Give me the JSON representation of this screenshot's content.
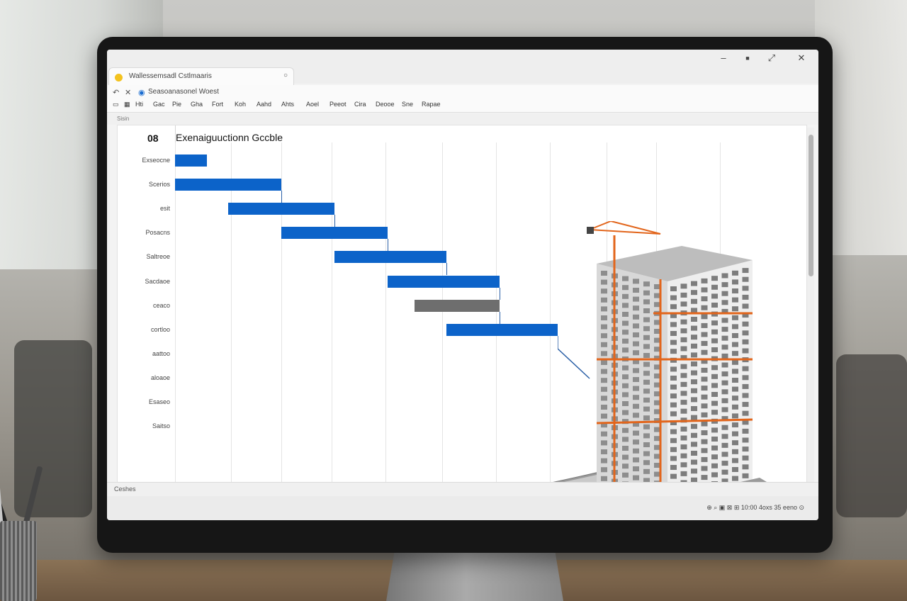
{
  "window": {
    "tab_title": "Wallessemsadl Cstlmaaris",
    "close_glyph": "○",
    "minimize_glyph": "–",
    "maximize_glyph": "■",
    "window_close_glyph": "✕"
  },
  "address_bar": {
    "back_glyph": "↶",
    "close_glyph": "✕",
    "text": "Seasoanasonel Woest"
  },
  "menu": {
    "items": [
      "Hti",
      "Gac",
      "Pie",
      "Gha",
      "Fort",
      "Koh",
      "Aahd",
      "Ahts",
      "Aoel",
      "Peeot",
      "Cira",
      "Deooe",
      "Sne",
      "Rapae"
    ]
  },
  "subbar": {
    "label": "Sisin"
  },
  "chart_data": {
    "type": "gantt",
    "id_label": "08",
    "title": "Exenaiguuctionn Gccble",
    "row_labels": [
      "Exseocne",
      "Scerios",
      "esit",
      "Posacns",
      "Saltreoe",
      "Sacdaoe",
      "ceaco",
      "cortloo",
      "aattoo",
      "aloaoe",
      "Esaseo",
      "Saitso"
    ],
    "tasks": [
      {
        "row": 0,
        "start": 0.0,
        "end": 0.6,
        "color": "#0c63c9"
      },
      {
        "row": 1,
        "start": 0.0,
        "end": 2.0,
        "color": "#0c63c9"
      },
      {
        "row": 2,
        "start": 1.0,
        "end": 3.0,
        "color": "#0c63c9"
      },
      {
        "row": 3,
        "start": 2.0,
        "end": 4.0,
        "color": "#0c63c9"
      },
      {
        "row": 4,
        "start": 3.0,
        "end": 5.1,
        "color": "#0c63c9"
      },
      {
        "row": 5,
        "start": 4.0,
        "end": 6.1,
        "color": "#0c63c9"
      },
      {
        "row": 6,
        "start": 4.5,
        "end": 6.1,
        "color": "#6e6e6e"
      },
      {
        "row": 7,
        "start": 5.1,
        "end": 7.2,
        "color": "#0c63c9"
      }
    ]
  },
  "statusbar": {
    "left_text": "Ceshes",
    "tray_text": "⊕ ⌕ ▣ ⊠ ⊞ 10:00 4oxs 35 eeno ⊙"
  },
  "colors": {
    "bar_blue": "#0c63c9",
    "bar_gray": "#6e6e6e",
    "crane_orange": "#e2651b"
  }
}
